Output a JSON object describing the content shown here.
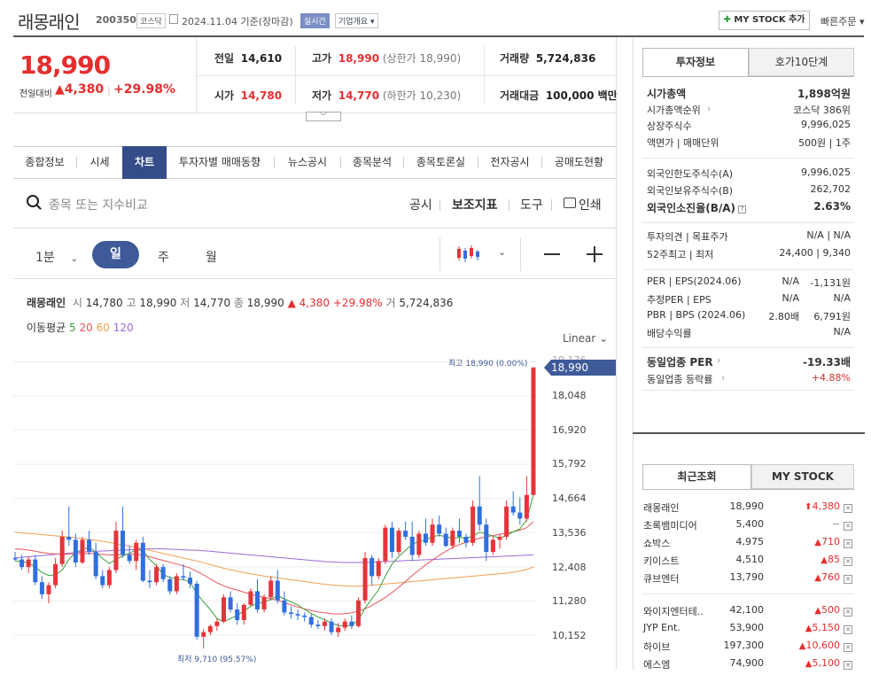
{
  "header": {
    "name": "래몽래인",
    "code": "200350",
    "market": "코스닥",
    "date": "2024.11.04 기준(장마감)",
    "realtime": "실시간",
    "company_info": "기업개요",
    "mystock_add": "MY STOCK 추가",
    "quick_order": "빠른주문"
  },
  "price": {
    "current": "18,990",
    "change_label": "전일대비",
    "change": "4,380",
    "change_pct": "+29.98%"
  },
  "quote": {
    "prev_label": "전일",
    "prev": "14,610",
    "high_label": "고가",
    "high": "18,990",
    "upper_limit": "(상한가 18,990)",
    "volume_label": "거래량",
    "volume": "5,724,836",
    "open_label": "시가",
    "open": "14,780",
    "low_label": "저가",
    "low": "14,770",
    "lower_limit": "(하한가 10,230)",
    "amount_label": "거래대금",
    "amount": "100,000 백만"
  },
  "tabs": [
    "종합정보",
    "시세",
    "차트",
    "투자자별 매매동향",
    "뉴스공시",
    "종목분석",
    "종목토론실",
    "전자공시",
    "공매도현황"
  ],
  "active_tab": "차트",
  "search": {
    "placeholder": "종목 또는 지수비교",
    "disclosure": "공시",
    "indicators": "보조지표",
    "tools": "도구",
    "print": "인쇄"
  },
  "periods": {
    "minute": "1분",
    "day": "일",
    "week": "주",
    "month": "월"
  },
  "chart_info": {
    "name": "래몽래인",
    "open_l": "시",
    "open": "14,780",
    "high_l": "고",
    "high": "18,990",
    "low_l": "저",
    "low": "14,770",
    "close_l": "종",
    "close": "18,990",
    "change": "▲ 4,380 +29.98%",
    "vol_l": "거",
    "vol": "5,724,836"
  },
  "ma": {
    "label": "이동평균",
    "p5": "5",
    "p20": "20",
    "p60": "60",
    "p120": "120",
    "c5": "#3aa03a",
    "c20": "#e8555c",
    "c60": "#f0a050",
    "c120": "#9b6bd6"
  },
  "scale": "Linear",
  "chart_data": {
    "type": "candlestick",
    "y_ticks": [
      "18,048",
      "16,920",
      "15,792",
      "14,664",
      "13,536",
      "12,408",
      "11,280",
      "10,152"
    ],
    "y_values": [
      18048,
      16920,
      15792,
      14664,
      13536,
      12408,
      11280,
      10152
    ],
    "ylim": [
      9600,
      19500
    ],
    "top_tick_partial": "19,176",
    "current_tag": "18,990",
    "max_label": "최고 18,990 (0.00%)",
    "min_label": "최저 9,710 (95.57%)",
    "up_color": "#e5343a",
    "down_color": "#2f6fe0",
    "candles": [
      [
        12700,
        12900,
        12600,
        12650
      ],
      [
        12650,
        12800,
        12300,
        12400
      ],
      [
        12400,
        12750,
        12200,
        12650
      ],
      [
        12650,
        12800,
        11800,
        11900
      ],
      [
        11900,
        12100,
        11350,
        11500
      ],
      [
        11500,
        11900,
        11200,
        11800
      ],
      [
        11800,
        12700,
        11700,
        12500
      ],
      [
        12500,
        13600,
        12400,
        13400
      ],
      [
        13400,
        14400,
        13100,
        13300
      ],
      [
        13300,
        13500,
        12400,
        12550
      ],
      [
        12550,
        13400,
        12500,
        13300
      ],
      [
        13300,
        13600,
        12800,
        12900
      ],
      [
        12900,
        13200,
        12000,
        12100
      ],
      [
        12100,
        12300,
        11700,
        11800
      ],
      [
        11800,
        12400,
        11700,
        12300
      ],
      [
        12300,
        13900,
        12200,
        13600
      ],
      [
        13600,
        14400,
        12700,
        12800
      ],
      [
        12800,
        13100,
        12500,
        12600
      ],
      [
        12600,
        13300,
        12300,
        13200
      ],
      [
        13200,
        13400,
        11900,
        11950
      ],
      [
        11950,
        12300,
        11700,
        11900
      ],
      [
        11900,
        12500,
        11800,
        12400
      ],
      [
        12400,
        12500,
        11900,
        12000
      ],
      [
        12000,
        12100,
        11500,
        11600
      ],
      [
        11600,
        12200,
        11500,
        12100
      ],
      [
        12100,
        12500,
        11950,
        12050
      ],
      [
        12050,
        12250,
        11700,
        11850
      ],
      [
        11850,
        11950,
        10000,
        10100
      ],
      [
        10100,
        10350,
        9710,
        10250
      ],
      [
        10250,
        10500,
        10150,
        10450
      ],
      [
        10450,
        10700,
        10300,
        10600
      ],
      [
        10600,
        11500,
        10550,
        11400
      ],
      [
        11400,
        11600,
        10900,
        11000
      ],
      [
        11000,
        11200,
        10500,
        10650
      ],
      [
        10650,
        11200,
        10500,
        11150
      ],
      [
        11150,
        11700,
        11100,
        11600
      ],
      [
        11600,
        12000,
        10900,
        11000
      ],
      [
        11000,
        11500,
        10900,
        11400
      ],
      [
        11400,
        12100,
        11300,
        11950
      ],
      [
        11950,
        12300,
        11200,
        11300
      ],
      [
        11300,
        11600,
        10800,
        10900
      ],
      [
        10900,
        11100,
        10700,
        10850
      ],
      [
        10850,
        11000,
        10650,
        10800
      ],
      [
        10800,
        10900,
        10600,
        10750
      ],
      [
        10750,
        10850,
        10400,
        10500
      ],
      [
        10500,
        10650,
        10350,
        10450
      ],
      [
        10450,
        10700,
        10300,
        10600
      ],
      [
        10600,
        10700,
        10150,
        10250
      ],
      [
        10250,
        10550,
        10100,
        10400
      ],
      [
        10400,
        10700,
        10300,
        10600
      ],
      [
        10600,
        10800,
        10350,
        10450
      ],
      [
        10450,
        11400,
        10400,
        11300
      ],
      [
        11300,
        12900,
        11200,
        12700
      ],
      [
        12700,
        12800,
        11800,
        12100
      ],
      [
        12100,
        12700,
        12000,
        12600
      ],
      [
        12600,
        13800,
        12500,
        13700
      ],
      [
        13700,
        13900,
        12700,
        12900
      ],
      [
        12900,
        13700,
        12800,
        13600
      ],
      [
        13600,
        13900,
        13300,
        13400
      ],
      [
        13400,
        13900,
        12600,
        12800
      ],
      [
        12800,
        13600,
        12700,
        13500
      ],
      [
        13500,
        14000,
        13100,
        13200
      ],
      [
        13200,
        14000,
        13100,
        13800
      ],
      [
        13800,
        14100,
        13400,
        13500
      ],
      [
        13500,
        13700,
        13050,
        13100
      ],
      [
        13100,
        13700,
        13000,
        13600
      ],
      [
        13600,
        14000,
        13200,
        13400
      ],
      [
        13400,
        13500,
        13050,
        13200
      ],
      [
        13200,
        14600,
        13100,
        14400
      ],
      [
        14400,
        15400,
        13600,
        13800
      ],
      [
        13800,
        14000,
        12600,
        12900
      ],
      [
        12900,
        13400,
        12800,
        13300
      ],
      [
        13300,
        13500,
        13000,
        13400
      ],
      [
        13400,
        14600,
        13300,
        14400
      ],
      [
        14400,
        14900,
        14100,
        14200
      ],
      [
        14200,
        14700,
        13800,
        14000
      ],
      [
        14000,
        15400,
        13900,
        14780
      ],
      [
        14780,
        18990,
        14770,
        18990
      ]
    ],
    "ma5": [
      12600,
      12580,
      12540,
      12400,
      12220,
      12120,
      12140,
      12300,
      12650,
      12880,
      12980,
      13050,
      12900,
      12680,
      12520,
      12650,
      12770,
      12850,
      12980,
      12940,
      12650,
      12450,
      12150,
      12060,
      12000,
      11990,
      11900,
      11530,
      11250,
      11000,
      10700,
      10600,
      10700,
      10800,
      10950,
      11100,
      11200,
      11250,
      11330,
      11450,
      11350,
      11250,
      11150,
      11000,
      10870,
      10750,
      10660,
      10550,
      10470,
      10460,
      10480,
      10650,
      11050,
      11350,
      11650,
      12100,
      12500,
      12750,
      12950,
      13150,
      13250,
      13300,
      13400,
      13450,
      13400,
      13350,
      13380,
      13350,
      13420,
      13550,
      13500,
      13420,
      13360,
      13450,
      13560,
      13660,
      13950,
      14800
    ],
    "ma20": [
      13000,
      12990,
      12960,
      12920,
      12880,
      12850,
      12830,
      12820,
      12830,
      12840,
      12840,
      12850,
      12840,
      12820,
      12800,
      12800,
      12810,
      12820,
      12820,
      12790,
      12740,
      12680,
      12620,
      12560,
      12500,
      12440,
      12370,
      12260,
      12140,
      12010,
      11880,
      11780,
      11700,
      11640,
      11570,
      11500,
      11450,
      11400,
      11350,
      11300,
      11230,
      11150,
      11080,
      11020,
      10960,
      10920,
      10890,
      10860,
      10850,
      10860,
      10890,
      10940,
      11020,
      11130,
      11260,
      11400,
      11560,
      11740,
      11920,
      12120,
      12300,
      12470,
      12630,
      12780,
      12920,
      13040,
      13140,
      13220,
      13290,
      13350,
      13400,
      13440,
      13480,
      13520,
      13560,
      13620,
      13700,
      13900
    ],
    "ma60": [
      13550,
      13530,
      13510,
      13490,
      13470,
      13450,
      13430,
      13410,
      13390,
      13370,
      13340,
      13310,
      13280,
      13250,
      13210,
      13170,
      13130,
      13090,
      13050,
      13000,
      12950,
      12900,
      12850,
      12800,
      12750,
      12700,
      12650,
      12600,
      12540,
      12480,
      12420,
      12360,
      12310,
      12260,
      12220,
      12180,
      12140,
      12100,
      12070,
      12040,
      12010,
      11980,
      11950,
      11920,
      11890,
      11860,
      11830,
      11810,
      11790,
      11780,
      11770,
      11770,
      11780,
      11800,
      11820,
      11840,
      11860,
      11880,
      11900,
      11920,
      11940,
      11960,
      11980,
      12000,
      12020,
      12040,
      12060,
      12080,
      12100,
      12120,
      12140,
      12160,
      12180,
      12200,
      12230,
      12270,
      12320,
      12400
    ],
    "ma120": [
      12700,
      12720,
      12740,
      12760,
      12780,
      12800,
      12820,
      12840,
      12860,
      12880,
      12900,
      12910,
      12920,
      12930,
      12940,
      12950,
      12960,
      12970,
      12980,
      12990,
      13000,
      13000,
      13000,
      12990,
      12980,
      12970,
      12960,
      12950,
      12940,
      12920,
      12900,
      12880,
      12860,
      12840,
      12820,
      12800,
      12780,
      12760,
      12740,
      12720,
      12700,
      12680,
      12660,
      12640,
      12620,
      12600,
      12580,
      12570,
      12560,
      12550,
      12550,
      12550,
      12550,
      12560,
      12570,
      12580,
      12590,
      12600,
      12610,
      12620,
      12630,
      12640,
      12650,
      12660,
      12670,
      12680,
      12690,
      12700,
      12710,
      12720,
      12730,
      12740,
      12750,
      12760,
      12770,
      12780,
      12790,
      12800
    ]
  },
  "right_tabs": {
    "info": "투자정보",
    "hoga": "호가10단계"
  },
  "invest_info": [
    {
      "k": "시가총액",
      "v": "1,898억원",
      "bold": true
    },
    {
      "k": "시가총액순위",
      "v": "코스닥 386위",
      "arrow": true
    },
    {
      "k": "상장주식수",
      "v": "9,996,025"
    },
    {
      "k": "액면가 | 매매단위",
      "v": "500원 | 1주"
    }
  ],
  "foreign_info": [
    {
      "k": "외국인한도주식수(A)",
      "v": "9,996,025"
    },
    {
      "k": "외국인보유주식수(B)",
      "v": "262,702"
    },
    {
      "k": "외국인소진율(B/A)",
      "v": "2.63%",
      "bold": true,
      "ibox": true
    }
  ],
  "target_info": [
    {
      "k": "투자의견 | 목표주가",
      "v": "N/A | N/A"
    },
    {
      "k": "52주최고 | 최저",
      "v": "24,400 | 9,340"
    }
  ],
  "per_info": [
    {
      "k": "PER | EPS(2024.06)",
      "v1": "N/A",
      "v2": "-1,131원"
    },
    {
      "k": "추정PER | EPS",
      "v1": "N/A",
      "v2": "N/A"
    },
    {
      "k": "PBR | BPS (2024.06)",
      "v1": "2.80배",
      "v2": "6,791원"
    },
    {
      "k": "배당수익률",
      "v1": "",
      "v2": "N/A"
    }
  ],
  "industry": {
    "per_label": "동일업종 PER",
    "per": "-19.33배",
    "rate_label": "동일업종 등락률",
    "rate": "+4.88%"
  },
  "recent_tabs": {
    "recent": "최근조회",
    "mystock": "MY STOCK"
  },
  "recent": [
    {
      "name": "래몽래인",
      "price": "18,990",
      "chg": "4,380",
      "dir": "upper"
    },
    {
      "name": "초록뱀미디어",
      "price": "5,400",
      "chg": "−",
      "dir": "flat"
    },
    {
      "name": "쇼박스",
      "price": "4,975",
      "chg": "710",
      "dir": "up"
    },
    {
      "name": "키이스트",
      "price": "4,510",
      "chg": "85",
      "dir": "up"
    },
    {
      "name": "큐브엔터",
      "price": "13,790",
      "chg": "760",
      "dir": "up"
    },
    {
      "name": "와이지엔터테..",
      "price": "42,100",
      "chg": "500",
      "dir": "up"
    },
    {
      "name": "JYP Ent.",
      "price": "53,900",
      "chg": "5,150",
      "dir": "up"
    },
    {
      "name": "하이브",
      "price": "197,300",
      "chg": "10,600",
      "dir": "up"
    },
    {
      "name": "에스엠",
      "price": "74,900",
      "chg": "5,100",
      "dir": "up"
    }
  ]
}
